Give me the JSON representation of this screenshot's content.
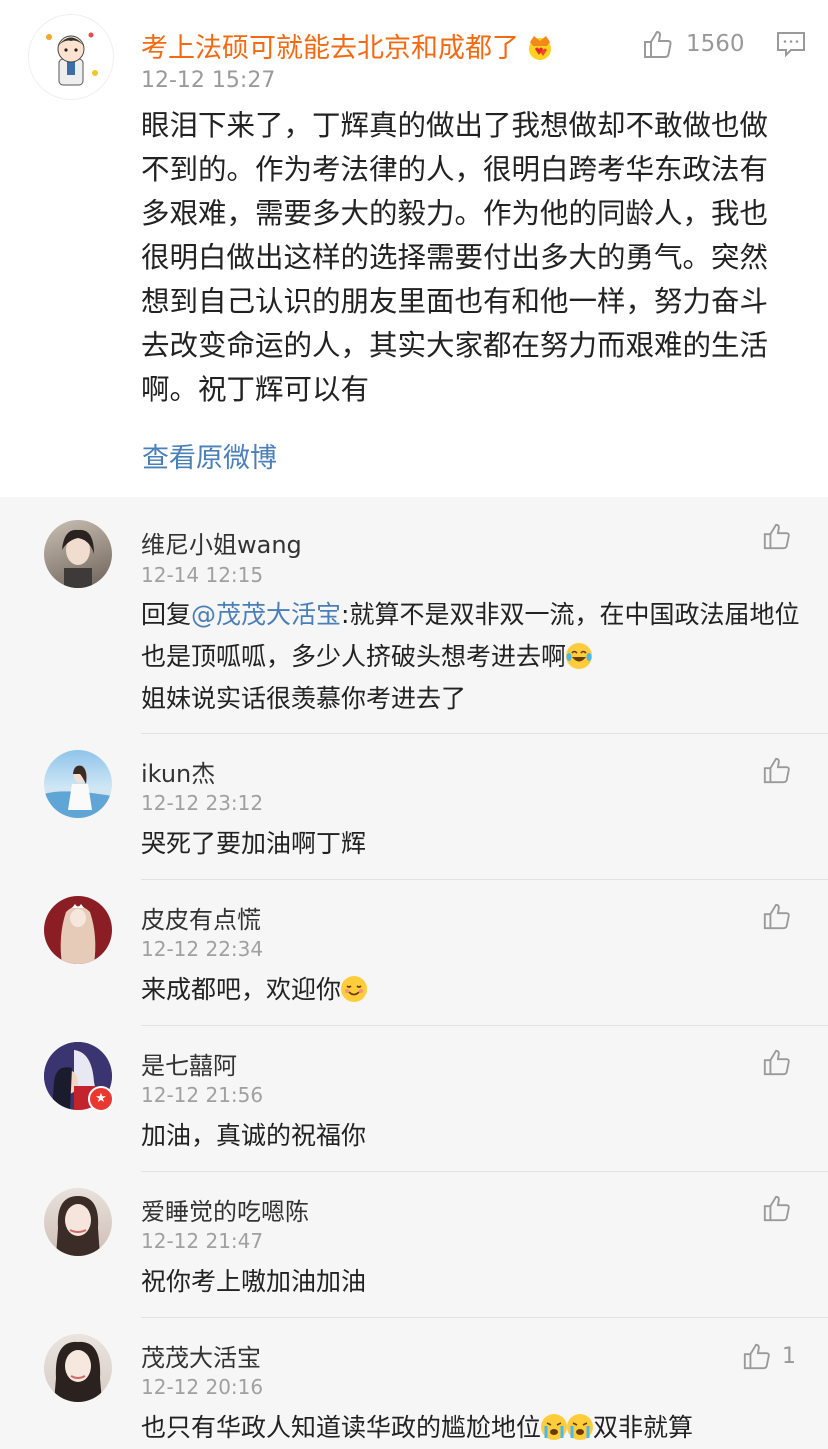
{
  "post": {
    "author": "考上法硕可就能去北京和成都了",
    "time": "12-12 15:27",
    "likes": "1560",
    "text": "眼泪下来了，丁辉真的做出了我想做却不敢做也做不到的。作为考法律的人，很明白跨考华东政法有多艰难，需要多大的毅力。作为他的同龄人，我也很明白做出这样的选择需要付出多大的勇气。突然想到自己认识的朋友里面也有和他一样，努力奋斗去改变命运的人，其实大家都在努力而艰难的生活啊。祝丁辉可以有",
    "view_original": "查看原微博"
  },
  "replies": [
    {
      "name": "维尼小姐wang",
      "time": "12-14 12:15",
      "prefix": "回复",
      "mention": "@茂茂大活宝",
      "text1": ":就算不是双非双一流，在中国政法届地位也是顶呱呱，多少人挤破头想考进去啊",
      "text2": "姐妹说实话很羡慕你考进去了",
      "likes": ""
    },
    {
      "name": "ikun杰",
      "time": "12-12 23:12",
      "text": "哭死了要加油啊丁辉",
      "likes": ""
    },
    {
      "name": "皮皮有点慌",
      "time": "12-12 22:34",
      "text": "来成都吧，欢迎你",
      "likes": ""
    },
    {
      "name": "是七囍阿",
      "time": "12-12 21:56",
      "text": "加油，真诚的祝福你",
      "likes": ""
    },
    {
      "name": "爱睡觉的吃嗯陈",
      "time": "12-12 21:47",
      "text": "祝你考上嗷加油加油",
      "likes": ""
    },
    {
      "name": "茂茂大活宝",
      "time": "12-12 20:16",
      "text1": "也只有华政人知道读华政的尴尬地位",
      "text2": "双非就算",
      "likes": "1"
    }
  ],
  "icons": {
    "like": "thumbs-up-icon",
    "comment": "comment-icon",
    "crown": "crown-badge-icon",
    "laugh": "laughing-tears-emoji",
    "smile": "smile-emoji",
    "cry": "crying-emoji"
  },
  "colors": {
    "author_orange": "#f36a12",
    "link_blue": "#4a7fb8",
    "reply_bg": "#f6f6f6"
  }
}
